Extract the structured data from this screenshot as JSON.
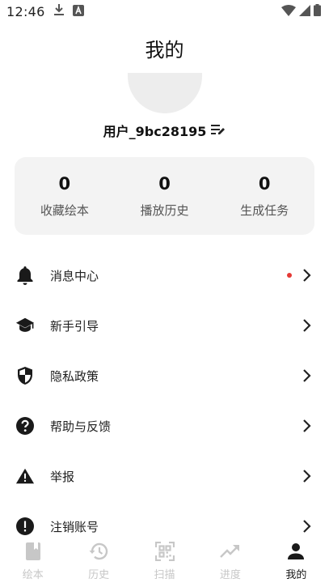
{
  "status_bar": {
    "time": "12:46"
  },
  "header": {
    "title": "我的"
  },
  "profile": {
    "username": "用户_9bc28195"
  },
  "stats": [
    {
      "value": "0",
      "label": "收藏绘本"
    },
    {
      "value": "0",
      "label": "播放历史"
    },
    {
      "value": "0",
      "label": "生成任务"
    }
  ],
  "menu": {
    "items": [
      {
        "label": "消息中心",
        "icon": "bell-icon",
        "badge": "unread-dot"
      },
      {
        "label": "新手引导",
        "icon": "graduation-cap-icon"
      },
      {
        "label": "隐私政策",
        "icon": "shield-icon"
      },
      {
        "label": "帮助与反馈",
        "icon": "help-icon"
      },
      {
        "label": "举报",
        "icon": "warning-icon"
      },
      {
        "label": "注销账号",
        "icon": "alert-circle-icon"
      }
    ]
  },
  "bottom_nav": {
    "items": [
      {
        "label": "绘本",
        "icon": "book-icon"
      },
      {
        "label": "历史",
        "icon": "history-icon"
      },
      {
        "label": "扫描",
        "icon": "scan-icon"
      },
      {
        "label": "进度",
        "icon": "trending-icon"
      },
      {
        "label": "我的",
        "icon": "person-icon",
        "active": true
      }
    ]
  },
  "colors": {
    "accent_dot": "#e53935",
    "card_bg": "#f3f3f3",
    "inactive_nav": "#c7c7c7"
  }
}
